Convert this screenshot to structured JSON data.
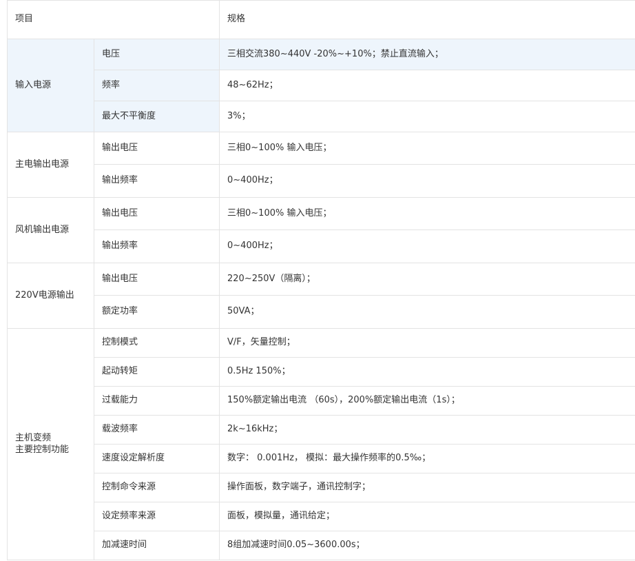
{
  "header": {
    "item_label": "项目",
    "spec_label": "规格"
  },
  "groups": [
    {
      "name": "输入电源",
      "highlight": true,
      "rows": [
        {
          "param": "电压",
          "spec": "三相交流380~440V -20%~+10%；禁止直流输入；"
        },
        {
          "param": "频率",
          "spec": "48~62Hz；"
        },
        {
          "param": "最大不平衡度",
          "spec": "3%；"
        }
      ]
    },
    {
      "name": "主电输出电源",
      "rows": [
        {
          "param": "输出电压",
          "spec": "三相0~100% 输入电压；"
        },
        {
          "param": "输出频率",
          "spec": "0~400Hz；"
        }
      ]
    },
    {
      "name": "风机输出电源",
      "rows": [
        {
          "param": "输出电压",
          "spec": "三相0~100% 输入电压；"
        },
        {
          "param": "输出频率",
          "spec": "0~400Hz；"
        }
      ]
    },
    {
      "name": "220V电源输出",
      "rows": [
        {
          "param": "输出电压",
          "spec": "220~250V（隔离）；"
        },
        {
          "param": "额定功率",
          "spec": "50VA；"
        }
      ]
    },
    {
      "name_line1": "主机变频",
      "name_line2": "主要控制功能",
      "rows": [
        {
          "param": "控制模式",
          "spec": "V/F，矢量控制；"
        },
        {
          "param": "起动转矩",
          "spec": "0.5Hz   150%；"
        },
        {
          "param": "过载能力",
          "spec": "150%额定输出电流 （60s），200%额定输出电流（1s）；"
        },
        {
          "param": "载波频率",
          "spec": "2k~16kHz；"
        },
        {
          "param": "速度设定解析度",
          "spec": "数字： 0.001Hz， 模拟：最大操作频率的0.5‰；"
        },
        {
          "param": "控制命令来源",
          "spec": "操作面板，数字端子，通讯控制字；"
        },
        {
          "param": "设定频率来源",
          "spec": "面板，模拟量，通讯给定；"
        },
        {
          "param": "加减速时间",
          "spec": "8组加减速时间0.05~3600.00s；"
        }
      ]
    }
  ]
}
